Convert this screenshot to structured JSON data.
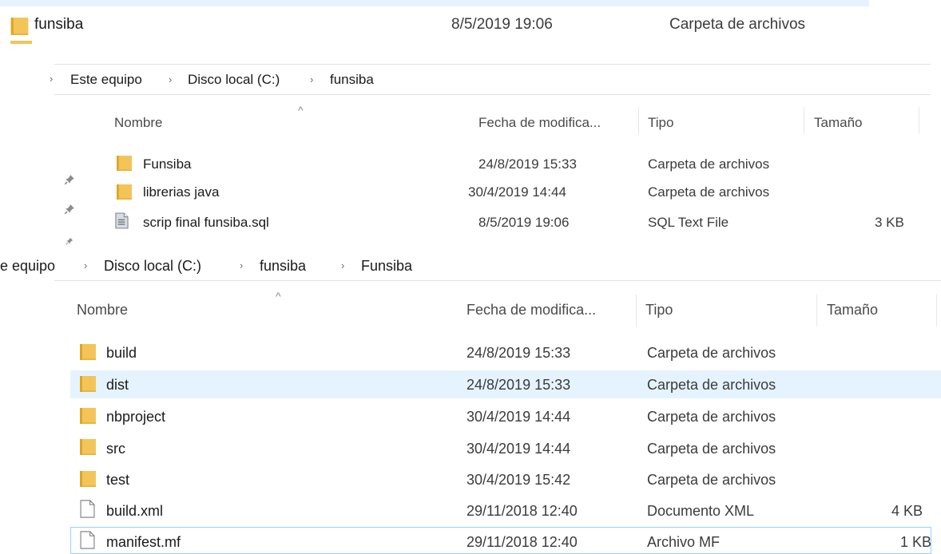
{
  "top_row": {
    "name": "funsiba",
    "date": "8/5/2019 19:06",
    "type": "Carpeta de archivos"
  },
  "panel1": {
    "breadcrumb": [
      "Este equipo",
      "Disco local (C:)",
      "funsiba"
    ],
    "columns": {
      "name": "Nombre",
      "date": "Fecha de modifica...",
      "type": "Tipo",
      "size": "Tamaño"
    },
    "rows": [
      {
        "name": "Funsiba",
        "date": "24/8/2019 15:33",
        "type": "Carpeta de archivos",
        "size": "",
        "icon": "folder-icon"
      },
      {
        "name": "librerias java",
        "date": "30/4/2019 14:44",
        "type": "Carpeta de archivos",
        "size": "",
        "icon": "folder-icon"
      },
      {
        "name": "scrip final funsiba.sql",
        "date": "8/5/2019 19:06",
        "type": "SQL Text File",
        "size": "3 KB",
        "icon": "sql-file-icon"
      }
    ]
  },
  "panel2": {
    "breadcrumb": [
      "e equipo",
      "Disco local (C:)",
      "funsiba",
      "Funsiba"
    ],
    "columns": {
      "name": "Nombre",
      "date": "Fecha de modifica...",
      "type": "Tipo",
      "size": "Tamaño"
    },
    "rows": [
      {
        "name": "build",
        "date": "24/8/2019 15:33",
        "type": "Carpeta de archivos",
        "size": "",
        "icon": "folder-icon"
      },
      {
        "name": "dist",
        "date": "24/8/2019 15:33",
        "type": "Carpeta de archivos",
        "size": "",
        "icon": "folder-icon"
      },
      {
        "name": "nbproject",
        "date": "30/4/2019 14:44",
        "type": "Carpeta de archivos",
        "size": "",
        "icon": "folder-icon"
      },
      {
        "name": "src",
        "date": "30/4/2019 14:44",
        "type": "Carpeta de archivos",
        "size": "",
        "icon": "folder-icon"
      },
      {
        "name": "test",
        "date": "30/4/2019 15:42",
        "type": "Carpeta de archivos",
        "size": "",
        "icon": "folder-icon"
      },
      {
        "name": "build.xml",
        "date": "29/11/2018 12:40",
        "type": "Documento XML",
        "size": "4 KB",
        "icon": "file-icon"
      },
      {
        "name": "manifest.mf",
        "date": "29/11/2018 12:40",
        "type": "Archivo MF",
        "size": "1 KB",
        "icon": "file-icon"
      }
    ]
  },
  "icons": {
    "pin": "pin-icon",
    "folder": "folder-icon",
    "file": "file-icon",
    "sql": "sql-file-icon",
    "chevron": "chevron-right-icon"
  },
  "colors": {
    "folder": "#f3c559",
    "selection": "#e5f3ff",
    "focus_border": "#99d1ff"
  }
}
